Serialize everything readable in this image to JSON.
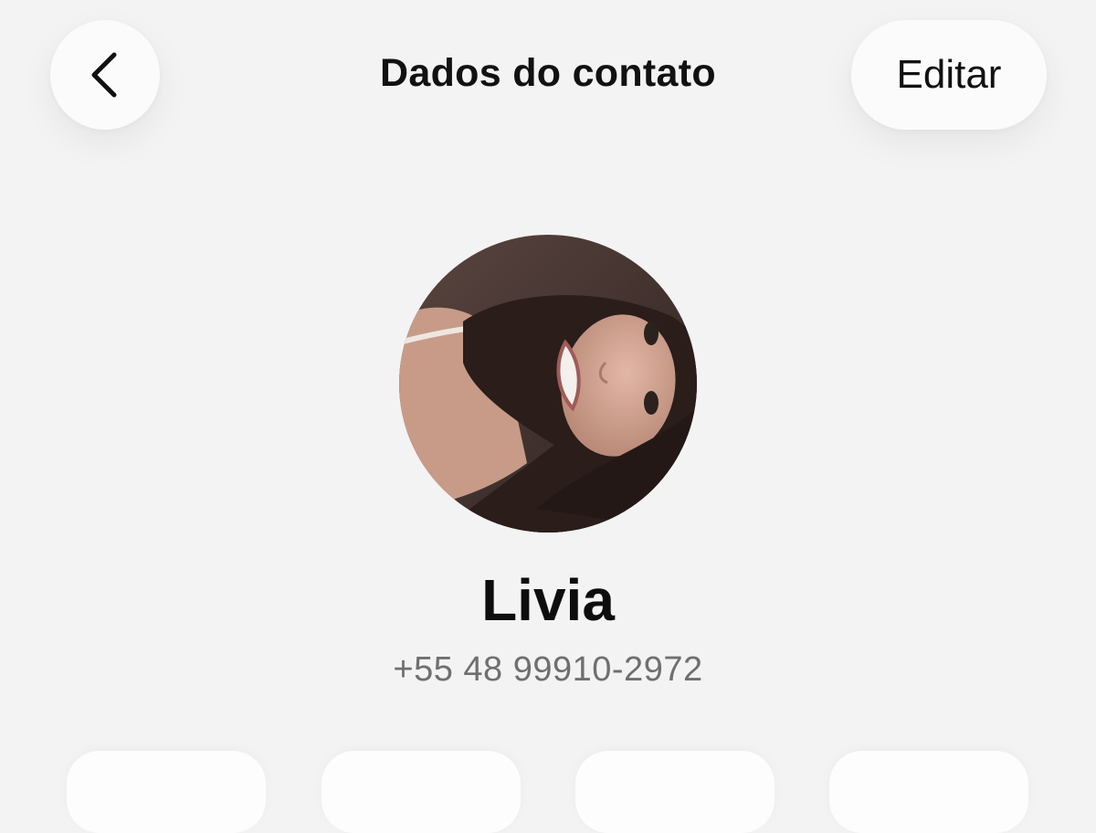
{
  "header": {
    "title": "Dados do contato",
    "back_icon": "chevron-left-icon",
    "edit_label": "Editar"
  },
  "contact": {
    "name": "Livia",
    "phone": "+55 48 99910-2972",
    "avatar": "profile-photo"
  },
  "action_cards": [
    {
      "icon": "action-card-1"
    },
    {
      "icon": "action-card-2"
    },
    {
      "icon": "action-card-3"
    },
    {
      "icon": "action-card-4"
    }
  ],
  "colors": {
    "background": "#f3f3f3",
    "button_bg": "#fbfbfb",
    "text_primary": "#111111",
    "text_secondary": "#6f6f6f"
  }
}
